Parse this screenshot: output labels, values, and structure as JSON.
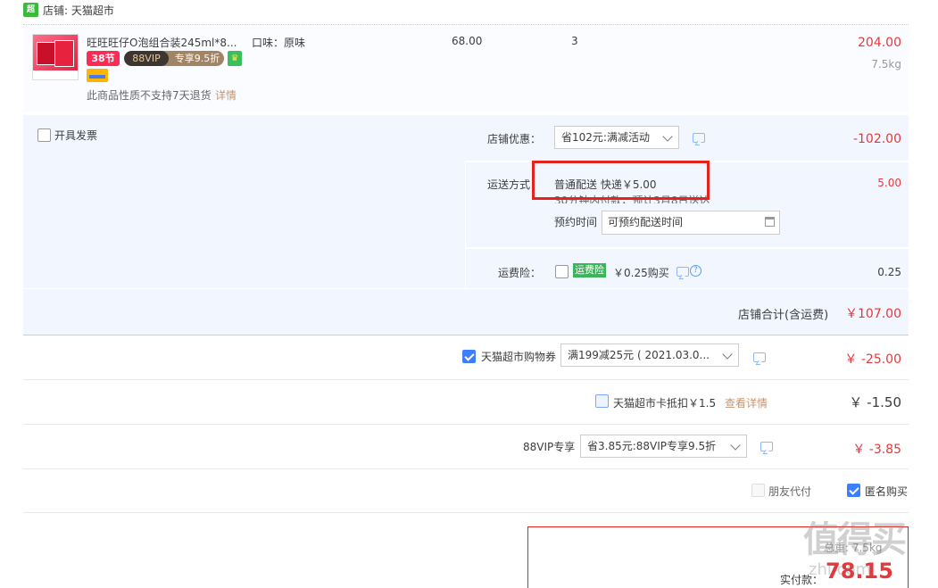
{
  "shop": {
    "icon": "shop-icon",
    "icon_text": "超市",
    "name": "店铺: 天猫超市"
  },
  "item": {
    "title": "旺旺旺仔O泡组合装245ml*8...",
    "tag_38": "38节",
    "tag_vip": "88VIP",
    "tag_vip_discount": "专享9.5折",
    "attr": "口味：原味",
    "unit_price": "68.00",
    "qty": "3",
    "subtotal": "204.00",
    "weight": "7.5kg",
    "no_return": "此商品性质不支持7天退货",
    "no_return_link": "详情"
  },
  "invoice": {
    "label": "开具发票",
    "checked": false
  },
  "shop_discount": {
    "label": "店铺优惠：",
    "select": "省102元:满减活动",
    "value": "-102.00"
  },
  "shipping": {
    "label": "运送方式：",
    "method": "普通配送 快递￥5.00",
    "hint": "30分钟内付款，预计3月8日送达",
    "value": "5.00",
    "reserve_label": "预约时间",
    "reserve_placeholder": "可预约配送时间"
  },
  "insurance": {
    "label": "运费险：",
    "badge": "运费险",
    "text": "￥0.25购买",
    "help": "?",
    "value": "0.25"
  },
  "shop_total": {
    "label": "店铺合计(含运费)",
    "value": "￥107.00"
  },
  "coupon": {
    "label": "天猫超市购物券",
    "select": "满199减25元 ( 2021.03.0...",
    "value": "￥ -25.00",
    "checked": true
  },
  "card": {
    "label": "天猫超市卡抵扣￥1.5",
    "link": "查看详情",
    "value": "￥ -1.50"
  },
  "vip": {
    "label": "88VIP专享",
    "select": "省3.85元:88VIP专享9.5折",
    "value": "￥ -3.85"
  },
  "options": {
    "friend_pay": "朋友代付",
    "anonymous": "匿名购买"
  },
  "pay": {
    "weight": "总重: 7.5kg",
    "label": "实付款：",
    "value": "78.15"
  },
  "watermark": {
    "main": "值得买",
    "sub": "zhi.com"
  },
  "colors": {
    "accent_red": "#e4393c",
    "panel_blue": "#f2f7ff",
    "highlight_box": "#e5231c"
  }
}
